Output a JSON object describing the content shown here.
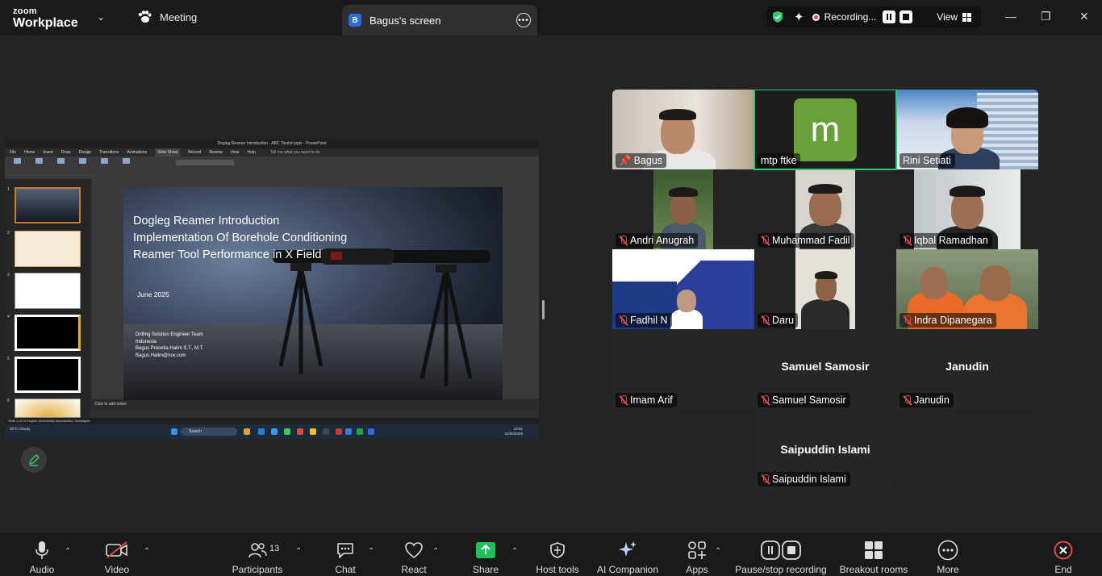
{
  "app": {
    "brand_line1": "zoom",
    "brand_line2": "Workplace"
  },
  "tabs": {
    "meeting": "Meeting",
    "screen": "Bagus's screen",
    "screen_badge": "B"
  },
  "recording": {
    "label": "Recording...",
    "view": "View"
  },
  "shared_screen": {
    "window_title": "Dogleg Reamer Introduction - ABC Tinukiri.pptx - PowerPoint",
    "menu": [
      "File",
      "Home",
      "Insert",
      "Draw",
      "Design",
      "Transitions",
      "Animations",
      "Slide Show",
      "Record",
      "Review",
      "View",
      "Help"
    ],
    "tell_me": "Tell me what you want to do",
    "slide": {
      "title_lines": [
        "Dogleg Reamer Introduction",
        "Implementation Of Borehole Conditioning",
        "Reamer Tool Performance in X Field"
      ],
      "date": "June 2025",
      "team_lines": [
        "Drilling Solution Engineer Team",
        "Indonesia",
        "Bagus Prasetia Halim S.T., M.T.",
        "Bagus.Halim@nov.com"
      ]
    },
    "notes_placeholder": "Click to add notes",
    "status": "Slide 1 of 10     English (Indonesia)     Accessibility: Investigate",
    "taskbar": {
      "search": "Search",
      "clock_time": "13:51",
      "clock_date": "21/06/2025",
      "weather": "28°C Cloudy"
    }
  },
  "participants": [
    {
      "name": "Bagus",
      "status": "pinned"
    },
    {
      "name": "mtp ftke",
      "avatar_letter": "m",
      "status": "active"
    },
    {
      "name": "Rini Setiati",
      "status": "unmuted"
    },
    {
      "name": "Andri Anugrah",
      "status": "muted"
    },
    {
      "name": "Muhammad Fadil",
      "status": "muted"
    },
    {
      "name": "Iqbal Ramadhan",
      "status": "muted"
    },
    {
      "name": "Fadhil N",
      "status": "muted"
    },
    {
      "name": "Daru",
      "status": "muted"
    },
    {
      "name": "Indra Dipanegara",
      "status": "muted"
    },
    {
      "name": "Imam Arif",
      "status": "muted"
    },
    {
      "name": "Samuel Samosir",
      "status": "muted"
    },
    {
      "name": "Janudin",
      "status": "muted"
    },
    {
      "name": "Saipuddin Islami",
      "status": "muted"
    }
  ],
  "toolbar": {
    "audio": "Audio",
    "video": "Video",
    "participants": "Participants",
    "participants_count": "13",
    "chat": "Chat",
    "react": "React",
    "share": "Share",
    "host_tools": "Host tools",
    "ai_companion": "AI Companion",
    "apps": "Apps",
    "pause_recording": "Pause/stop recording",
    "breakout": "Breakout rooms",
    "more": "More",
    "end": "End"
  },
  "colors": {
    "accent_green": "#2dcc70",
    "share_green": "#1fbf5a",
    "mute_red": "#e34b4b",
    "end_red": "#e34b4b"
  }
}
